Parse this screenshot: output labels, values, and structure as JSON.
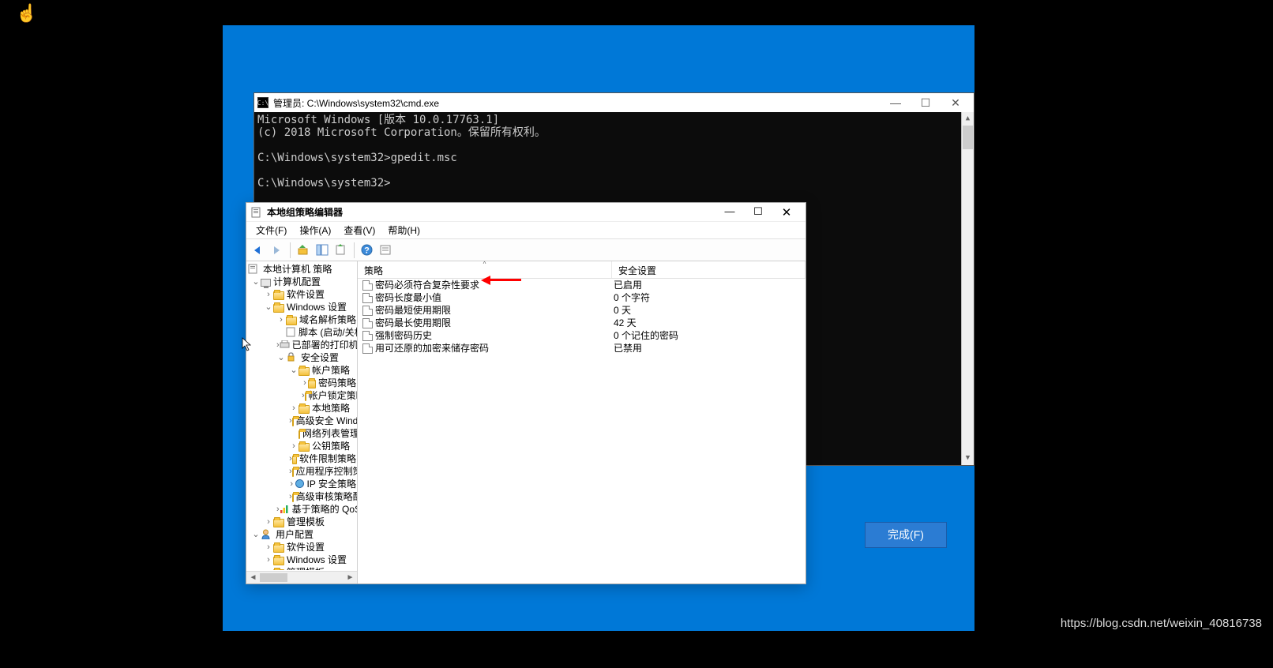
{
  "installer": {
    "finish_btn": "完成(F)"
  },
  "cmd": {
    "title": "管理员:  C:\\Windows\\system32\\cmd.exe",
    "line1": "Microsoft Windows [版本 10.0.17763.1]",
    "line2": "(c) 2018 Microsoft Corporation。保留所有权利。",
    "line3": "C:\\Windows\\system32>gpedit.msc",
    "line4": "C:\\Windows\\system32>"
  },
  "gpedit": {
    "title": "本地组策略编辑器",
    "menu": {
      "file": "文件(F)",
      "action": "操作(A)",
      "view": "查看(V)",
      "help": "帮助(H)"
    },
    "tree": {
      "root": "本地计算机 策略",
      "cc": "计算机配置",
      "sw1": "软件设置",
      "win": "Windows 设置",
      "dns": "域名解析策略",
      "script": "脚本 (启动/关机)",
      "printers": "已部署的打印机",
      "sec": "安全设置",
      "acct": "帐户策略",
      "pwd": "密码策略",
      "lockout": "帐户锁定策略",
      "local": "本地策略",
      "advsec": "高级安全 Windows",
      "netlist": "网络列表管理器策略",
      "pubkey": "公钥策略",
      "swrestrict": "软件限制策略",
      "appctrl": "应用程序控制策略",
      "ipsec": "IP 安全策略",
      "advaudit": "高级审核策略配置",
      "qos": "基于策略的 QoS",
      "admin1": "管理模板",
      "uc": "用户配置",
      "sw2": "软件设置",
      "win2": "Windows 设置",
      "admin2": "管理模板"
    },
    "list": {
      "headers": {
        "policy": "策略",
        "security": "安全设置"
      },
      "rows": [
        {
          "name": "密码必须符合复杂性要求",
          "value": "已启用"
        },
        {
          "name": "密码长度最小值",
          "value": "0 个字符"
        },
        {
          "name": "密码最短使用期限",
          "value": "0 天"
        },
        {
          "name": "密码最长使用期限",
          "value": "42 天"
        },
        {
          "name": "强制密码历史",
          "value": "0 个记住的密码"
        },
        {
          "name": "用可还原的加密来储存密码",
          "value": "已禁用"
        }
      ]
    }
  },
  "watermark": "https://blog.csdn.net/weixin_40816738"
}
